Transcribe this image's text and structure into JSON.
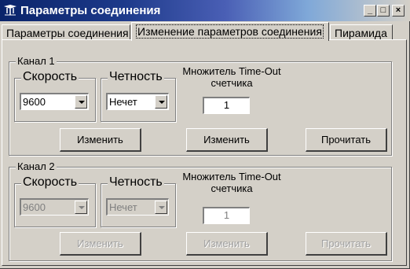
{
  "window": {
    "title": "Параметры соединения",
    "controls": {
      "minimize": "_",
      "maximize": "□",
      "close": "×"
    }
  },
  "tabs": [
    {
      "label": "Параметры соединения",
      "active": false
    },
    {
      "label": "Изменение параметров соединения",
      "active": true
    },
    {
      "label": "Пирамида",
      "active": false
    }
  ],
  "channel1": {
    "title": "Канал 1",
    "speed_label": "Скорость",
    "speed_value": "9600",
    "parity_label": "Четность",
    "parity_value": "Нечет",
    "multiplier_label_line1": "Множитель Time-Out",
    "multiplier_label_line2": "счетчика",
    "multiplier_value": "1",
    "btn_change_speed": "Изменить",
    "btn_change_multiplier": "Изменить",
    "btn_read": "Прочитать"
  },
  "channel2": {
    "title": "Канал 2",
    "speed_label": "Скорость",
    "speed_value": "9600",
    "parity_label": "Четность",
    "parity_value": "Нечет",
    "multiplier_label_line1": "Множитель Time-Out",
    "multiplier_label_line2": "счетчика",
    "multiplier_value": "1",
    "btn_change_speed": "Изменить",
    "btn_change_multiplier": "Изменить",
    "btn_read": "Прочитать"
  },
  "colors": {
    "face": "#d4d0c8",
    "title_start": "#0a246a",
    "disabled_text": "#808080"
  }
}
